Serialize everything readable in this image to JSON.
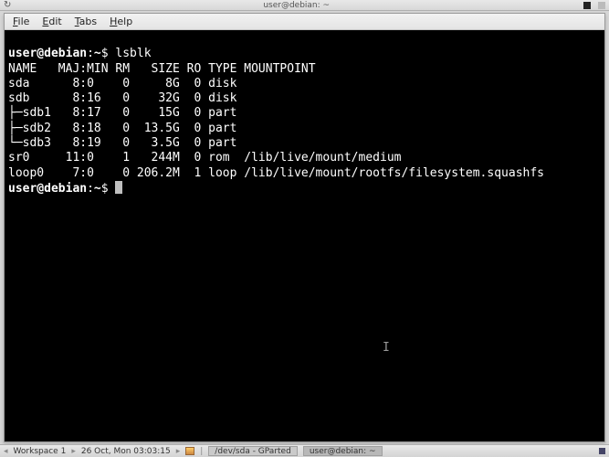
{
  "top_panel": {
    "title": "user@debian: ~"
  },
  "menubar": {
    "file": "File",
    "edit": "Edit",
    "tabs": "Tabs",
    "help": "Help"
  },
  "terminal": {
    "prompt_userhost": "user@debian",
    "prompt_path": "~",
    "prompt_symbol": "$",
    "command": "lsblk",
    "header": "NAME   MAJ:MIN RM   SIZE RO TYPE MOUNTPOINT",
    "rows": [
      "sda      8:0    0     8G  0 disk ",
      "sdb      8:16   0    32G  0 disk ",
      "├─sdb1   8:17   0    15G  0 part ",
      "├─sdb2   8:18   0  13.5G  0 part ",
      "└─sdb3   8:19   0   3.5G  0 part ",
      "sr0     11:0    1   244M  0 rom  /lib/live/mount/medium",
      "loop0    7:0    0 206.2M  1 loop /lib/live/mount/rootfs/filesystem.squashfs"
    ]
  },
  "bottom_panel": {
    "workspace": "Workspace 1",
    "datetime": "26 Oct, Mon 03:03:15",
    "task1": "/dev/sda - GParted",
    "task2": "user@debian: ~"
  }
}
